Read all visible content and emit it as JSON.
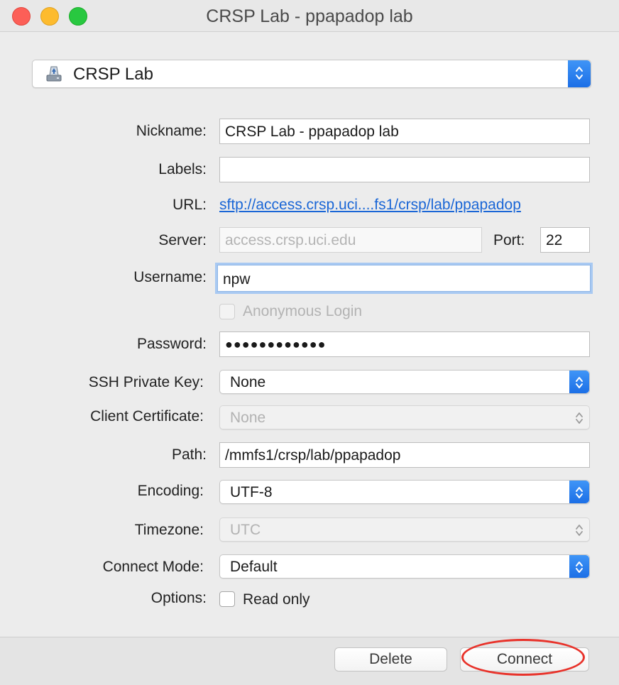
{
  "window": {
    "title": "CRSP Lab - ppapadop lab"
  },
  "bookmark": {
    "selected": "CRSP Lab",
    "icon": "drive-icon"
  },
  "form": {
    "nickname": {
      "label": "Nickname:",
      "value": "CRSP Lab - ppapadop lab"
    },
    "labels": {
      "label": "Labels:",
      "value": ""
    },
    "url": {
      "label": "URL:",
      "value": "sftp://access.crsp.uci....fs1/crsp/lab/ppapadop"
    },
    "server": {
      "label": "Server:",
      "value": "access.crsp.uci.edu"
    },
    "port": {
      "label": "Port:",
      "value": "22"
    },
    "username": {
      "label": "Username:",
      "value": "npw"
    },
    "anonymous": {
      "label": "Anonymous Login",
      "checked": false
    },
    "password": {
      "label": "Password:",
      "value": "●●●●●●●●●●●●"
    },
    "ssh_key": {
      "label": "SSH Private Key:",
      "value": "None"
    },
    "client_cert": {
      "label": "Client Certificate:",
      "value": "None"
    },
    "path": {
      "label": "Path:",
      "value": "/mmfs1/crsp/lab/ppapadop"
    },
    "encoding": {
      "label": "Encoding:",
      "value": "UTF-8"
    },
    "timezone": {
      "label": "Timezone:",
      "value": "UTC"
    },
    "connect_mode": {
      "label": "Connect Mode:",
      "value": "Default"
    },
    "options": {
      "label": "Options:",
      "read_only_label": "Read only",
      "read_only_checked": false
    }
  },
  "footer": {
    "delete_label": "Delete",
    "connect_label": "Connect"
  },
  "colors": {
    "accent": "#1c6fe6",
    "link": "#1a66d6",
    "annotation": "#e8322a"
  }
}
